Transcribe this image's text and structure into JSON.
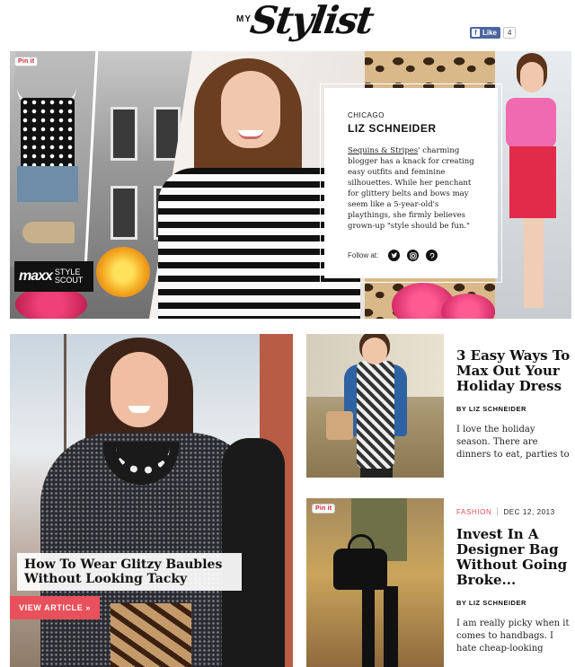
{
  "header": {
    "logo_small": "MY",
    "logo_script": "Stylist",
    "like_label": "Like",
    "like_count": "4"
  },
  "hero": {
    "pin_label": "Pin it",
    "badge_brand": "maxx",
    "badge_sub1": "STYLE",
    "badge_sub2": "SCOUT",
    "card": {
      "city": "CHICAGO",
      "name": "LIZ SCHNEIDER",
      "bio_link": "Sequins & Stripes",
      "bio_rest": "' charming blogger has a knack for creating easy outfits and feminine silhouettes. While her penchant for glittery belts and bows may seem like a 5-year-old's playthings, she firmly believes grown-up \"style should be fun.\"",
      "follow_label": "Follow at:",
      "social_icons": [
        "twitter-icon",
        "instagram-icon",
        "pinterest-icon"
      ]
    }
  },
  "feature": {
    "title": "How To Wear Glitzy Baubles Without Looking Tacky",
    "cta": "VIEW ARTICLE »"
  },
  "articles": [
    {
      "title": "3 Easy Ways To Max Out Your Holiday Dress",
      "byline": "BY LIZ SCHNEIDER",
      "excerpt": "I love the holiday season. There are dinners to eat, parties to"
    },
    {
      "pin_label": "Pin it",
      "category": "FASHION",
      "date": "DEC 12, 2013",
      "title": "Invest In A Designer Bag Without Going Broke...",
      "byline": "BY LIZ SCHNEIDER",
      "excerpt": "I am really picky when it comes to handbags. I hate cheap-looking"
    }
  ],
  "colors": {
    "accent": "#e8505b",
    "facebook": "#4a66a0"
  }
}
